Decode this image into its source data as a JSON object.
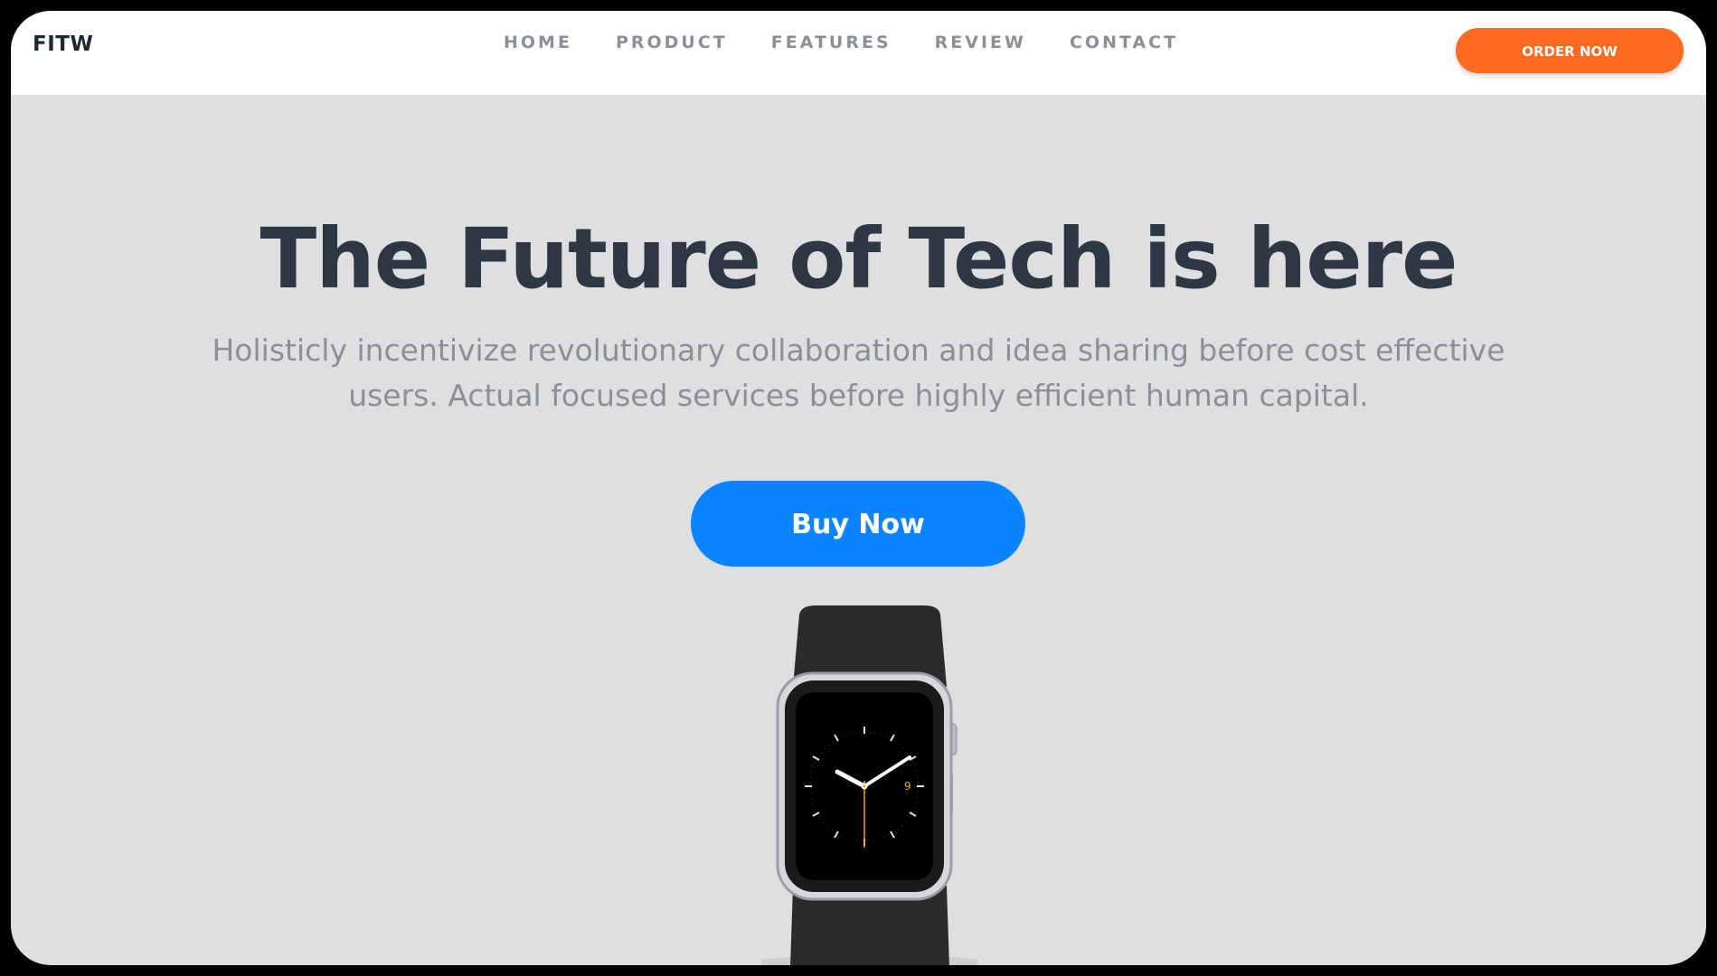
{
  "header": {
    "brand": "FITW",
    "nav": [
      {
        "label": "HOME"
      },
      {
        "label": "PRODUCT"
      },
      {
        "label": "FEATURES"
      },
      {
        "label": "REVIEW"
      },
      {
        "label": "CONTACT"
      }
    ],
    "order_button": "ORDER NOW"
  },
  "hero": {
    "headline": "The Future of Tech is here",
    "subtext": "Holisticly incentivize revolutionary collaboration and idea sharing before cost effective users. Actual focused services before highly efficient human capital.",
    "buy_button": "Buy Now",
    "watch_face_numeral": "9"
  },
  "colors": {
    "order_button_bg": "#ff6a21",
    "buy_button_bg": "#0a85ff",
    "hero_bg": "#dfdfe1",
    "headline": "#2e3844",
    "subtext": "#8a9099",
    "nav_link": "#8a9097"
  }
}
